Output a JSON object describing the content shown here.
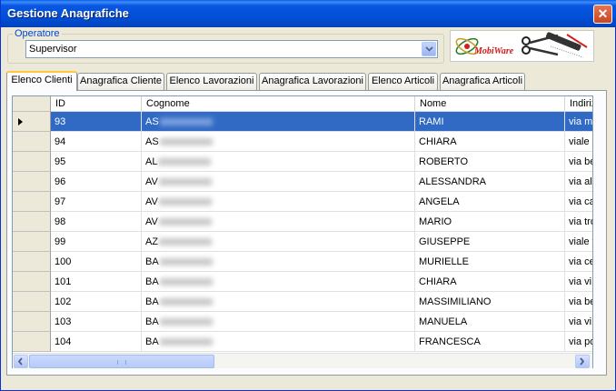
{
  "window": {
    "title": "Gestione Anagrafiche",
    "close_glyph": "✕"
  },
  "operator": {
    "label": "Operatore",
    "value": "Supervisor"
  },
  "logo": {
    "text": "MobiWare"
  },
  "tabs": [
    {
      "label": "Elenco Clienti",
      "active": true
    },
    {
      "label": "Anagrafica Cliente",
      "active": false
    },
    {
      "label": "Elenco Lavorazioni",
      "active": false
    },
    {
      "label": "Anagrafica Lavorazioni",
      "active": false
    },
    {
      "label": "Elenco Articoli",
      "active": false
    },
    {
      "label": "Anagrafica Articoli",
      "active": false
    }
  ],
  "grid": {
    "columns": [
      "ID",
      "Cognome",
      "Nome",
      "Indiriz"
    ],
    "rows": [
      {
        "id": "93",
        "cognome": "AS",
        "nome": "RAMI",
        "indirizzo": "via m",
        "selected": true
      },
      {
        "id": "94",
        "cognome": "AS",
        "nome": "CHIARA",
        "indirizzo": "viale s"
      },
      {
        "id": "95",
        "cognome": "AL",
        "nome": "ROBERTO",
        "indirizzo": "via be"
      },
      {
        "id": "96",
        "cognome": "AV",
        "nome": "ALESSANDRA",
        "indirizzo": "via ale"
      },
      {
        "id": "97",
        "cognome": "AV",
        "nome": "ANGELA",
        "indirizzo": "via ca"
      },
      {
        "id": "98",
        "cognome": "AV",
        "nome": "MARIO",
        "indirizzo": "via tro"
      },
      {
        "id": "99",
        "cognome": "AZ",
        "nome": "GIUSEPPE",
        "indirizzo": "viale t"
      },
      {
        "id": "100",
        "cognome": "BA",
        "nome": "MURIELLE",
        "indirizzo": "via ce"
      },
      {
        "id": "101",
        "cognome": "BA",
        "nome": "CHIARA",
        "indirizzo": "via vi"
      },
      {
        "id": "102",
        "cognome": "BA",
        "nome": "MASSIMILIANO",
        "indirizzo": "via be"
      },
      {
        "id": "103",
        "cognome": "BA",
        "nome": "MANUELA",
        "indirizzo": "via vi"
      },
      {
        "id": "104",
        "cognome": "BA",
        "nome": "FRANCESCA",
        "indirizzo": "via po"
      }
    ]
  },
  "icons": {
    "close": "close-icon",
    "combo": "chevron-down-icon",
    "row_pointer": "row-pointer-icon",
    "scroll_left": "arrow-left-icon",
    "scroll_right": "arrow-right-icon"
  },
  "colors": {
    "titlebar": "#0050D8",
    "selection": "#316AC5",
    "active_tab_accent": "#FFC83C",
    "group_label": "#0046D5"
  }
}
